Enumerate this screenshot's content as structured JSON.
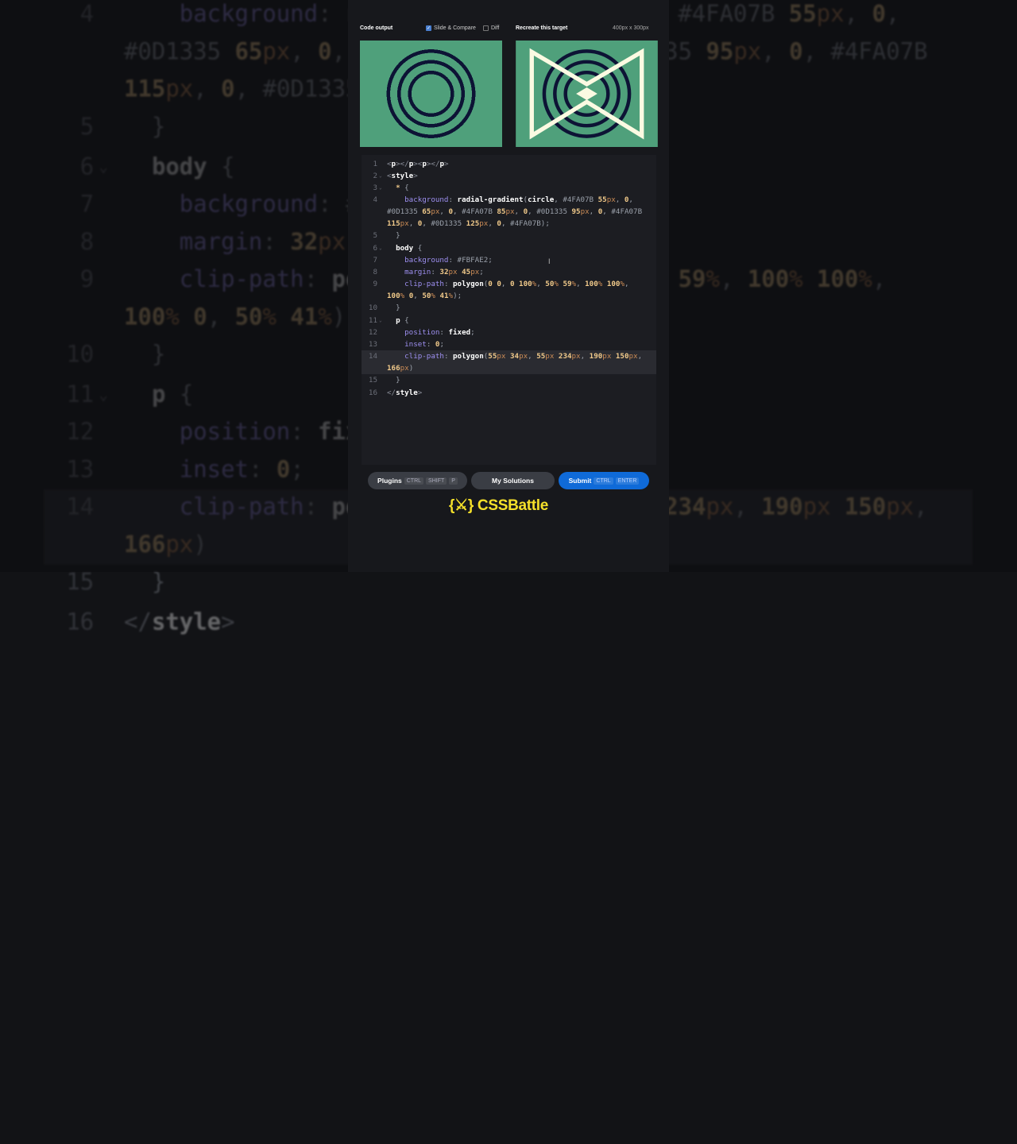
{
  "header": {
    "code_output": "Code output",
    "slide_compare": "Slide & Compare",
    "diff": "Diff",
    "recreate": "Recreate this target",
    "size": "400px x 300px"
  },
  "colors": {
    "green": "#4FA07B",
    "navy": "#0D1335",
    "cream": "#FBFAE2",
    "accent": "#0F6AD8",
    "logo": "#F5E02A"
  },
  "code_rows": [
    {
      "num": "1",
      "tokens": [
        [
          "t",
          "<"
        ],
        [
          "k",
          "p"
        ],
        [
          "t",
          "></"
        ],
        [
          "k",
          "p"
        ],
        [
          "t",
          "><"
        ],
        [
          "k",
          "p"
        ],
        [
          "t",
          "></"
        ],
        [
          "k",
          "p"
        ],
        [
          "t",
          ">"
        ]
      ]
    },
    {
      "num": "2",
      "fold": true,
      "tokens": [
        [
          "t",
          "<"
        ],
        [
          "k",
          "style"
        ],
        [
          "t",
          ">"
        ]
      ]
    },
    {
      "num": "3",
      "fold": true,
      "tokens": [
        [
          "v",
          "  "
        ],
        [
          "n",
          "*"
        ],
        [
          "s",
          " {"
        ]
      ]
    },
    {
      "num": "4",
      "tokens": [
        [
          "v",
          "    "
        ],
        [
          "p",
          "background"
        ],
        [
          "s",
          ": "
        ],
        [
          "k",
          "radial-gradient"
        ],
        [
          "s",
          "("
        ],
        [
          "k",
          "circle"
        ],
        [
          "s",
          ", "
        ],
        [
          "h",
          "#4FA07B "
        ],
        [
          "n",
          "55"
        ],
        [
          "u",
          "px"
        ],
        [
          "s",
          ", "
        ],
        [
          "n",
          "0"
        ],
        [
          "s",
          ","
        ]
      ]
    },
    {
      "num": "",
      "tokens": [
        [
          "h",
          "#0D1335 "
        ],
        [
          "n",
          "65"
        ],
        [
          "u",
          "px"
        ],
        [
          "s",
          ", "
        ],
        [
          "n",
          "0"
        ],
        [
          "s",
          ", "
        ],
        [
          "h",
          "#4FA07B "
        ],
        [
          "n",
          "85"
        ],
        [
          "u",
          "px"
        ],
        [
          "s",
          ", "
        ],
        [
          "n",
          "0"
        ],
        [
          "s",
          ", "
        ],
        [
          "h",
          "#0D1335 "
        ],
        [
          "n",
          "95"
        ],
        [
          "u",
          "px"
        ],
        [
          "s",
          ", "
        ],
        [
          "n",
          "0"
        ],
        [
          "s",
          ", "
        ],
        [
          "h",
          "#4FA07B"
        ]
      ]
    },
    {
      "num": "",
      "tokens": [
        [
          "n",
          "115"
        ],
        [
          "u",
          "px"
        ],
        [
          "s",
          ", "
        ],
        [
          "n",
          "0"
        ],
        [
          "s",
          ", "
        ],
        [
          "h",
          "#0D1335 "
        ],
        [
          "n",
          "125"
        ],
        [
          "u",
          "px"
        ],
        [
          "s",
          ", "
        ],
        [
          "n",
          "0"
        ],
        [
          "s",
          ", "
        ],
        [
          "h",
          "#4FA07B"
        ],
        [
          "s",
          ");"
        ]
      ]
    },
    {
      "num": "5",
      "tokens": [
        [
          "s",
          "  }"
        ]
      ]
    },
    {
      "num": "6",
      "fold": true,
      "tokens": [
        [
          "v",
          "  "
        ],
        [
          "k",
          "body"
        ],
        [
          "s",
          " {"
        ]
      ]
    },
    {
      "num": "7",
      "tokens": [
        [
          "v",
          "    "
        ],
        [
          "p",
          "background"
        ],
        [
          "s",
          ": "
        ],
        [
          "h",
          "#FBFAE2"
        ],
        [
          "s",
          ";"
        ]
      ]
    },
    {
      "num": "8",
      "tokens": [
        [
          "v",
          "    "
        ],
        [
          "p",
          "margin"
        ],
        [
          "s",
          ": "
        ],
        [
          "n",
          "32"
        ],
        [
          "u",
          "px "
        ],
        [
          "n",
          "45"
        ],
        [
          "u",
          "px"
        ],
        [
          "s",
          ";"
        ]
      ]
    },
    {
      "num": "9",
      "tokens": [
        [
          "v",
          "    "
        ],
        [
          "p",
          "clip-path"
        ],
        [
          "s",
          ": "
        ],
        [
          "k",
          "polygon"
        ],
        [
          "s",
          "("
        ],
        [
          "n",
          "0 0"
        ],
        [
          "s",
          ", "
        ],
        [
          "n",
          "0 100"
        ],
        [
          "u",
          "%"
        ],
        [
          "s",
          ", "
        ],
        [
          "n",
          "50"
        ],
        [
          "u",
          "% "
        ],
        [
          "n",
          "59"
        ],
        [
          "u",
          "%"
        ],
        [
          "s",
          ", "
        ],
        [
          "n",
          "100"
        ],
        [
          "u",
          "% "
        ],
        [
          "n",
          "100"
        ],
        [
          "u",
          "%"
        ],
        [
          "s",
          ","
        ]
      ]
    },
    {
      "num": "",
      "tokens": [
        [
          "n",
          "100"
        ],
        [
          "u",
          "% "
        ],
        [
          "n",
          "0"
        ],
        [
          "s",
          ", "
        ],
        [
          "n",
          "50"
        ],
        [
          "u",
          "% "
        ],
        [
          "n",
          "41"
        ],
        [
          "u",
          "%"
        ],
        [
          "s",
          ");"
        ]
      ]
    },
    {
      "num": "10",
      "tokens": [
        [
          "s",
          "  }"
        ]
      ]
    },
    {
      "num": "11",
      "fold": true,
      "tokens": [
        [
          "v",
          "  "
        ],
        [
          "k",
          "p"
        ],
        [
          "s",
          " {"
        ]
      ]
    },
    {
      "num": "12",
      "tokens": [
        [
          "v",
          "    "
        ],
        [
          "p",
          "position"
        ],
        [
          "s",
          ": "
        ],
        [
          "k",
          "fixed"
        ],
        [
          "s",
          ";"
        ]
      ]
    },
    {
      "num": "13",
      "tokens": [
        [
          "v",
          "    "
        ],
        [
          "p",
          "inset"
        ],
        [
          "s",
          ": "
        ],
        [
          "n",
          "0"
        ],
        [
          "s",
          ";"
        ]
      ]
    },
    {
      "num": "14",
      "hl": true,
      "tokens": [
        [
          "v",
          "    "
        ],
        [
          "p",
          "clip-path"
        ],
        [
          "s",
          ": "
        ],
        [
          "k",
          "polygon"
        ],
        [
          "s",
          "("
        ],
        [
          "n",
          "55"
        ],
        [
          "u",
          "px "
        ],
        [
          "n",
          "34"
        ],
        [
          "u",
          "px"
        ],
        [
          "s",
          ", "
        ],
        [
          "n",
          "55"
        ],
        [
          "u",
          "px "
        ],
        [
          "n",
          "234"
        ],
        [
          "u",
          "px"
        ],
        [
          "s",
          ", "
        ],
        [
          "n",
          "190"
        ],
        [
          "u",
          "px "
        ],
        [
          "n",
          "150"
        ],
        [
          "u",
          "px"
        ],
        [
          "s",
          ","
        ]
      ]
    },
    {
      "num": "",
      "hl": true,
      "tokens": [
        [
          "n",
          "166"
        ],
        [
          "u",
          "px"
        ],
        [
          "s",
          ")"
        ]
      ]
    },
    {
      "num": "15",
      "tokens": [
        [
          "s",
          "  }"
        ]
      ]
    },
    {
      "num": "16",
      "tokens": [
        [
          "t",
          "</"
        ],
        [
          "k",
          "style"
        ],
        [
          "t",
          ">"
        ]
      ]
    }
  ],
  "buttons": {
    "plugins": "Plugins",
    "plugins_keys": [
      "CTRL",
      "SHIFT",
      "P"
    ],
    "solutions": "My Solutions",
    "submit": "Submit",
    "submit_keys": [
      "CTRL",
      "ENTER"
    ]
  },
  "logo": "{⚔} CSSBattle"
}
